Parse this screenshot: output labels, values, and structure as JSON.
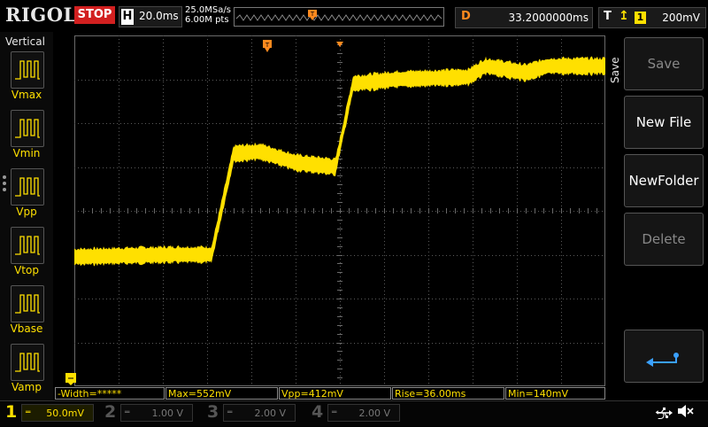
{
  "brand": "RIGOL",
  "run_state": "STOP",
  "horizontal": {
    "label": "H",
    "timebase": "20.0ms"
  },
  "acquisition": {
    "sample_rate": "25.0MSa/s",
    "memory_depth": "6.00M pts"
  },
  "delay": {
    "label": "D",
    "value": "33.2000000ms"
  },
  "trigger": {
    "label": "T",
    "edge_icon": "rising-edge-icon",
    "source": "1",
    "level": "200mV"
  },
  "vertical_menu": {
    "title": "Vertical",
    "items": [
      {
        "label": "Vmax",
        "icon": "vmax-measure-icon"
      },
      {
        "label": "Vmin",
        "icon": "vmin-measure-icon"
      },
      {
        "label": "Vpp",
        "icon": "vpp-measure-icon"
      },
      {
        "label": "Vtop",
        "icon": "vtop-measure-icon"
      },
      {
        "label": "Vbase",
        "icon": "vbase-measure-icon"
      },
      {
        "label": "Vamp",
        "icon": "vamp-measure-icon"
      }
    ]
  },
  "measurements": [
    {
      "text": "-Width=*****"
    },
    {
      "text": "Max=552mV"
    },
    {
      "text": "Vpp=412mV"
    },
    {
      "text": "Rise=36.00ms"
    },
    {
      "text": "Min=140mV"
    }
  ],
  "channels": [
    {
      "num": "1",
      "scale": "50.0mV",
      "color": "#ffe000",
      "active": true
    },
    {
      "num": "2",
      "scale": "1.00 V",
      "color": "#00c8d2",
      "active": false
    },
    {
      "num": "3",
      "scale": "2.00 V",
      "color": "#e040fb",
      "active": false
    },
    {
      "num": "4",
      "scale": "2.00 V",
      "color": "#3a7bff",
      "active": false
    }
  ],
  "side_menu": {
    "title": "Save",
    "buttons": [
      {
        "label": "Save",
        "enabled": false
      },
      {
        "label": "New File",
        "enabled": true
      },
      {
        "label": "NewFolder",
        "enabled": true
      },
      {
        "label": "Delete",
        "enabled": false
      }
    ],
    "back_icon": "return-arrow-icon"
  },
  "status_icons": [
    "usb-icon",
    "speaker-muted-icon"
  ],
  "colors": {
    "trace": "#ffe000",
    "trigger_marker": "#ff8a1e",
    "stop": "#d22020",
    "grid": "#5a5a5a"
  },
  "waveform": {
    "description_points_time_div": [
      [
        0.0,
        -1.05
      ],
      [
        2.2,
        -1.0
      ],
      [
        3.1,
        -1.0
      ],
      [
        3.6,
        1.3
      ],
      [
        4.2,
        1.35
      ],
      [
        5.0,
        1.1
      ],
      [
        5.9,
        1.0
      ],
      [
        6.3,
        2.9
      ],
      [
        7.3,
        3.0
      ],
      [
        8.9,
        3.05
      ],
      [
        9.3,
        3.3
      ],
      [
        10.2,
        3.15
      ],
      [
        10.7,
        3.3
      ],
      [
        12.0,
        3.3
      ]
    ]
  }
}
